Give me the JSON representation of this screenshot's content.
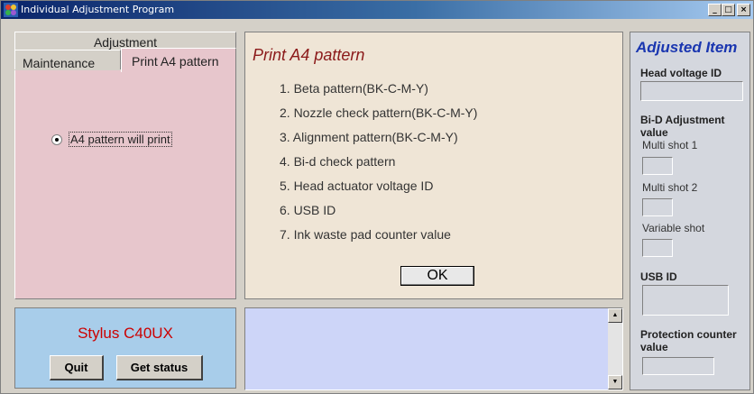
{
  "window": {
    "title": "Individual Adjustment Program",
    "controls": {
      "minimize": "_",
      "maximize": "□",
      "close": "×"
    }
  },
  "tabs": {
    "adjustment": "Adjustment",
    "maintenance": "Maintenance",
    "print_a4": "Print A4 pattern",
    "active": "Print A4 pattern"
  },
  "radio": {
    "label": "A4 pattern will print",
    "checked": true
  },
  "center": {
    "title": "Print A4 pattern",
    "items": [
      "1. Beta pattern(BK-C-M-Y)",
      "2. Nozzle check pattern(BK-C-M-Y)",
      "3. Alignment pattern(BK-C-M-Y)",
      "4. Bi-d check pattern",
      "5. Head actuator voltage ID",
      "6. USB ID",
      "7. Ink waste pad counter value"
    ],
    "ok_label": "OK"
  },
  "model": {
    "name": "Stylus C40UX",
    "quit_label": "Quit",
    "status_label": "Get status"
  },
  "log": {
    "text": ""
  },
  "right": {
    "title": "Adjusted Item",
    "head_voltage_label": "Head voltage ID",
    "bid_label_1": "Bi-D Adjustment",
    "bid_label_2": "value",
    "multi1": "Multi shot 1",
    "multi2": "Multi shot 2",
    "variable": "Variable shot",
    "usb_label": "USB ID",
    "protection_1": "Protection counter",
    "protection_2": "value"
  },
  "colors": {
    "tab_bg": "#e7c6cc",
    "center_bg": "#efe5d6",
    "model_bg": "#a8cdea",
    "log_bg": "#cdd5f8",
    "title_red": "#8b1a1a",
    "model_red": "#cc0000",
    "adjusted_blue": "#1a36b0"
  },
  "icons": {
    "app": "app-icon",
    "radio": "radio-selected-icon",
    "scroll_up": "scroll-up-arrow-icon",
    "scroll_down": "scroll-down-arrow-icon"
  }
}
